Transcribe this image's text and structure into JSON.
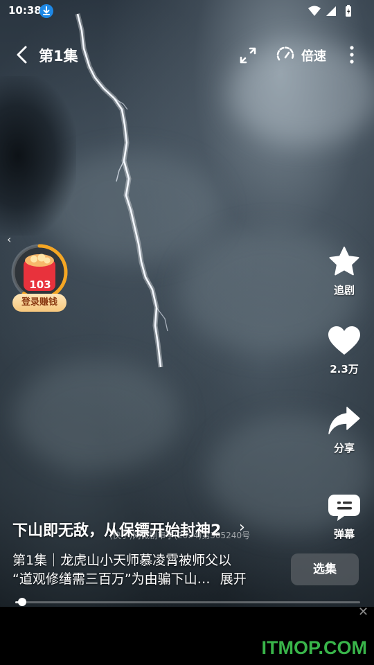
{
  "status_bar": {
    "time": "10:38"
  },
  "top_nav": {
    "episode_title": "第1集",
    "speed_label": "倍速"
  },
  "reward": {
    "count": "103",
    "label": "登录赚钱",
    "progress": 0.6
  },
  "right_rail": {
    "follow_label": "追剧",
    "likes_count": "2.3万",
    "share_label": "分享",
    "danmaku_label": "弹幕"
  },
  "info": {
    "drama_title": "下山即无敌，从保镖开始封神2",
    "license_text": "(快手)网微剧审字(2024)第305240号",
    "desc_line1": "第1集｜龙虎山小天师慕凌霄被师父以",
    "desc_line2": "“道观修缮需三百万”为由骗下山…",
    "expand_label": "展开",
    "episodes_button": "选集"
  },
  "progress": {
    "fraction": 0.02
  },
  "watermark": "ITMOP.COM",
  "colors": {
    "reward_ring": "#f5a623",
    "watermark": "#39b54a",
    "download_badge": "#1e88e5"
  }
}
